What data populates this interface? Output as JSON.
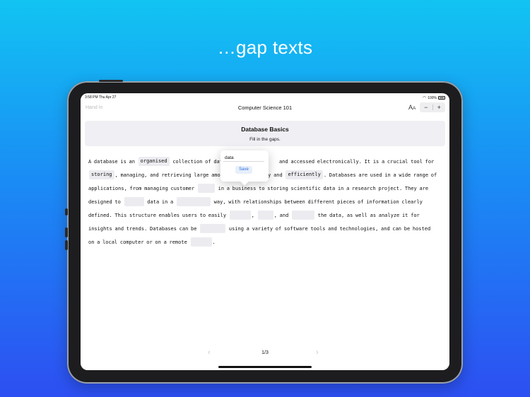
{
  "headline": "…gap texts",
  "status": {
    "time": "3:58 PM  Thu Apr 27",
    "battery": "100%"
  },
  "nav": {
    "left_label": "Hand In",
    "title": "Computer Science 101",
    "text_size_label": "A",
    "text_size_small": "A",
    "decrease_label": "−",
    "increase_label": "+"
  },
  "card": {
    "title": "Database Basics",
    "subtitle": "Fill in the gaps."
  },
  "passage": {
    "t1": "A database is an",
    "g1": "organised",
    "t2": "collection of dat",
    "t3": "and accessed electronically. It is a crucial tool for",
    "g2": "storing",
    "t4": ", managing, and retrieving large amou",
    "t5": "n quickly and",
    "g3": "efficiently",
    "t6": ". Databases are used in a wide range of applications, from managing customer",
    "t7": "in a business to storing scientific data in a research project. They are designed to",
    "t8": "data in a",
    "t9": "way, with relationships between different pieces of information clearly defined. This structure enables users to easily",
    "t10": ",",
    "t11": ", and",
    "t12": "the data, as well as analyze it for insights and trends. Databases can be",
    "t13": "using a variety of software tools and technologies, and can be hosted on a local computer or on a remote",
    "t14": "."
  },
  "popover": {
    "input_value": "data",
    "save_label": "Save"
  },
  "pager": {
    "prev": "‹",
    "page": "1/3",
    "next": "›"
  },
  "colors": {
    "accent": "#2a6de0",
    "gap_bg": "#ececf0",
    "card_bg": "#efeff4"
  }
}
